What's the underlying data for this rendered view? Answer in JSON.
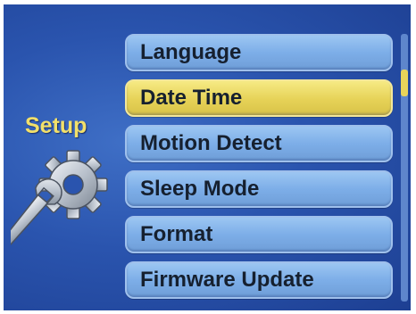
{
  "title": "Setup",
  "menu": {
    "items": [
      {
        "label": "Language",
        "selected": false
      },
      {
        "label": "Date Time",
        "selected": true
      },
      {
        "label": "Motion Detect",
        "selected": false
      },
      {
        "label": "Sleep Mode",
        "selected": false
      },
      {
        "label": "Format",
        "selected": false
      },
      {
        "label": "Firmware Update",
        "selected": false
      }
    ]
  },
  "icons": {
    "setup": "gear-wrench-icon"
  },
  "colors": {
    "background": "#2a54ae",
    "item": "#7daee8",
    "selected": "#e6d257",
    "title": "#f2e06a"
  }
}
